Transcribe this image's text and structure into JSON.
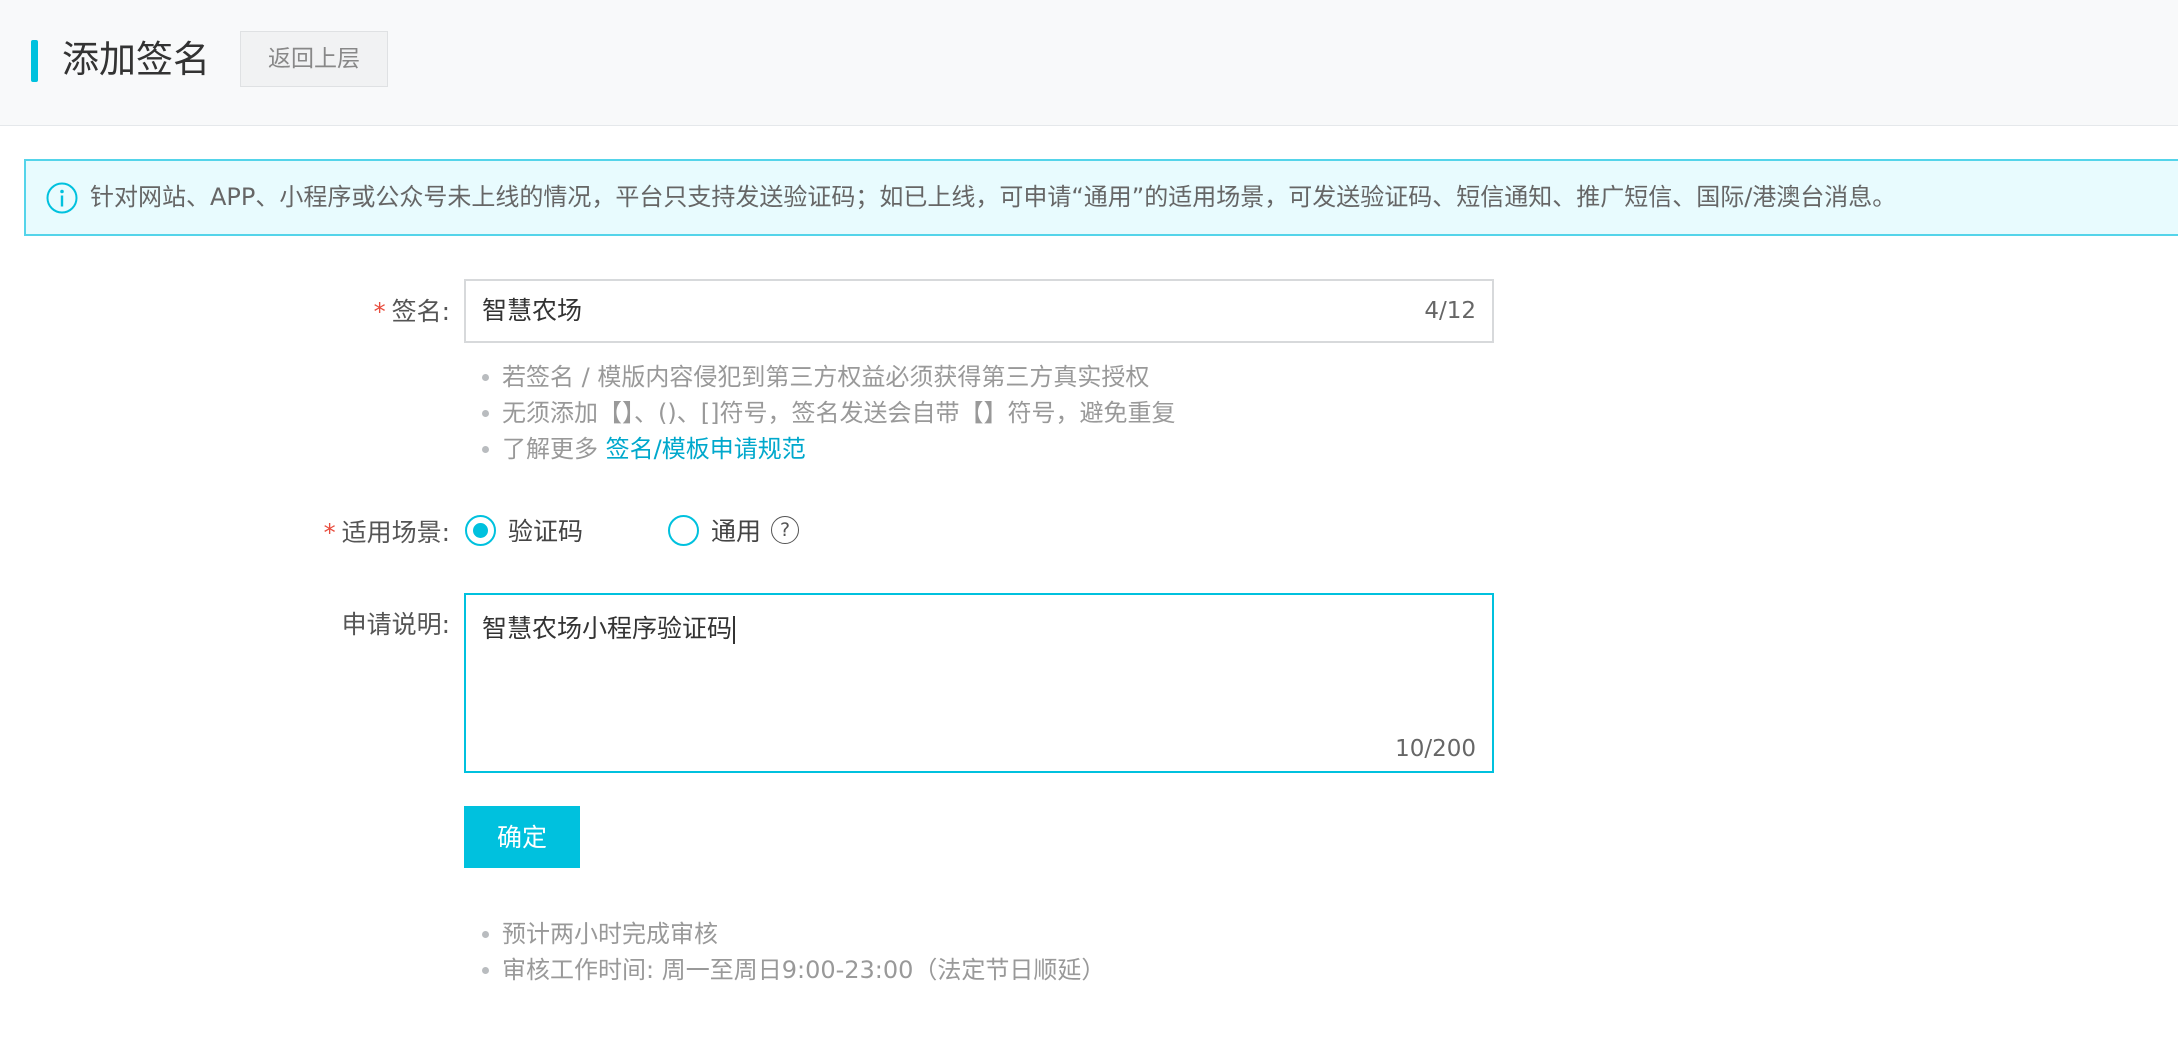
{
  "header": {
    "title": "添加签名",
    "back_label": "返回上层"
  },
  "notice": {
    "icon": "info-icon",
    "text": "针对网站、APP、小程序或公众号未上线的情况，平台只支持发送验证码；如已上线，可申请“通用”的适用场景，可发送验证码、短信通知、推广短信、国际/港澳台消息。"
  },
  "form": {
    "required_mark": "*",
    "signature": {
      "label": "签名:",
      "value": "智慧农场",
      "counter": "4/12"
    },
    "signature_tips": [
      {
        "text": "若签名 / 模版内容侵犯到第三方权益必须获得第三方真实授权"
      },
      {
        "text": "无须添加【】、()、[]符号，签名发送会自带【】符号，避免重复"
      },
      {
        "text": "了解更多 ",
        "link": "签名/模板申请规范"
      }
    ],
    "scenario": {
      "label": "适用场景:",
      "options": [
        {
          "label": "验证码",
          "checked": true
        },
        {
          "label": "通用",
          "checked": false,
          "help": "?"
        }
      ]
    },
    "description": {
      "label": "申请说明:",
      "value": "智慧农场小程序验证码",
      "counter": "10/200"
    },
    "confirm_label": "确定",
    "review_tips": [
      "预计两小时完成审核",
      "审核工作时间: 周一至周日9:00-23:00（法定节日顺延）"
    ]
  },
  "colors": {
    "accent": "#00c1de",
    "required": "#e84c3d",
    "link": "#00a8cc",
    "notice_bg": "#e8fbfe",
    "notice_border": "#54d4ea"
  }
}
